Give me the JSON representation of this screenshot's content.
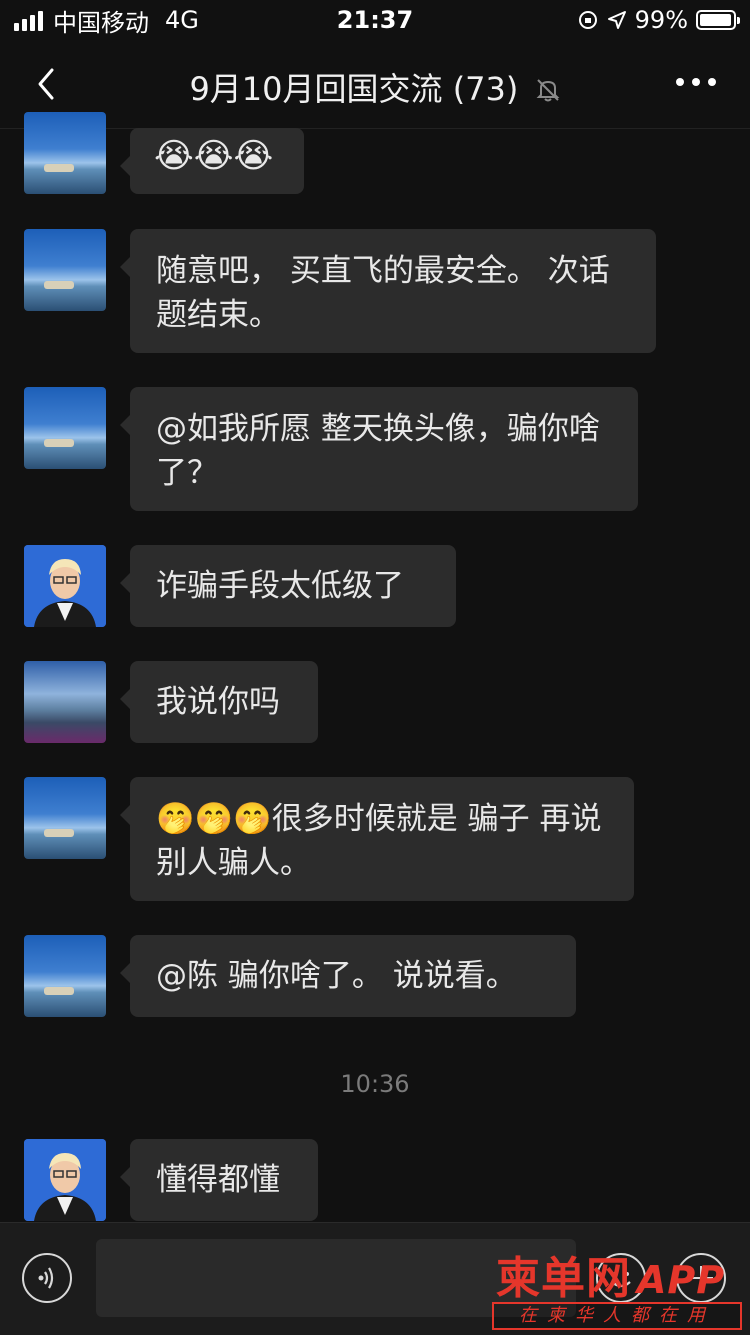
{
  "status_bar": {
    "carrier": "中国移动",
    "network": "4G",
    "time": "21:37",
    "battery": "99%"
  },
  "nav": {
    "title": "9月10月回国交流 (73)",
    "back_icon": "chevron-left-icon",
    "mute_icon": "bell-off-icon",
    "more_icon": "more-dots-icon"
  },
  "messages": [
    {
      "avatar": "sea-avatar",
      "text": "😭😭😭"
    },
    {
      "avatar": "sea-avatar",
      "text": "随意吧， 买直飞的最安全。 次话题结束。"
    },
    {
      "avatar": "sea-avatar",
      "text": "@如我所愿 整天换头像，骗你啥了？"
    },
    {
      "avatar": "person-avatar",
      "text": "诈骗手段太低级了"
    },
    {
      "avatar": "lake-avatar",
      "text": "我说你吗"
    },
    {
      "avatar": "sea-avatar",
      "text": "🤭🤭🤭很多时候就是 骗子 再说别人骗人。"
    },
    {
      "avatar": "sea-avatar",
      "text": "@陈 骗你啥了。 说说看。"
    },
    {
      "avatar": "person-avatar",
      "text": "懂得都懂"
    }
  ],
  "timestamp": "10:36",
  "input_bar": {
    "voice_icon": "voice-icon",
    "emoji_icon": "emoji-icon",
    "plus_icon": "plus-icon"
  },
  "watermark": {
    "brand": "柬单网",
    "app": "APP",
    "slogan": "在柬华人都在用"
  }
}
